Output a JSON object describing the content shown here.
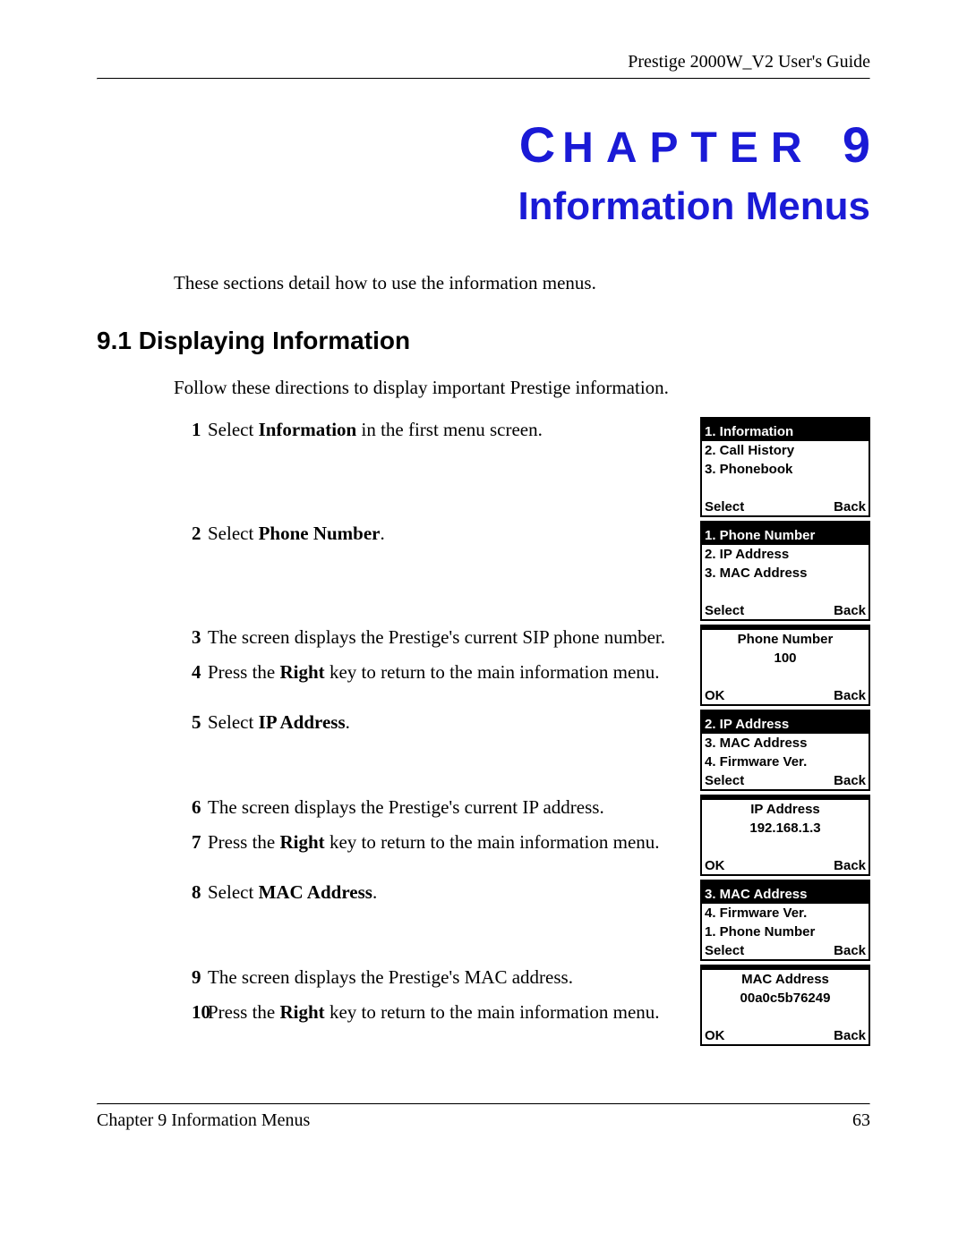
{
  "header": {
    "running_head": "Prestige 2000W_V2 User's Guide"
  },
  "chapter": {
    "label_prefix_letter": "C",
    "label_rest": "HAPTER",
    "number": "9",
    "title": "Information Menus",
    "intro": "These sections detail how to use the information menus."
  },
  "section": {
    "heading": "9.1  Displaying Information",
    "intro": "Follow these directions to display important Prestige information."
  },
  "steps": {
    "s1": {
      "num": "1",
      "t1": "Select ",
      "b1": "Information",
      "t2": " in the first menu screen."
    },
    "s2": {
      "num": "2",
      "t1": "Select ",
      "b1": "Phone Number",
      "t2": "."
    },
    "s3": {
      "num": "3",
      "txt": "The screen displays the Prestige's current SIP phone number."
    },
    "s4": {
      "num": "4",
      "t1": "Press the ",
      "b1": "Right",
      "t2": " key to return to the main information menu."
    },
    "s5": {
      "num": "5",
      "t1": "Select ",
      "b1": "IP Address",
      "t2": "."
    },
    "s6": {
      "num": "6",
      "txt": "The screen displays the Prestige's current IP address."
    },
    "s7": {
      "num": "7",
      "t1": "Press the ",
      "b1": "Right",
      "t2": " key to return to the main information menu."
    },
    "s8": {
      "num": "8",
      "t1": "Select ",
      "b1": "MAC Address",
      "t2": "."
    },
    "s9": {
      "num": "9",
      "txt": "The screen displays the Prestige's MAC address."
    },
    "s10": {
      "num": "10",
      "t1": "Press the ",
      "b1": "Right",
      "t2": " key to return to the main information menu."
    }
  },
  "screens": {
    "sc1": {
      "title": "1. Information",
      "row1": "2. Call History",
      "row2": "3. Phonebook",
      "left": "Select",
      "right": "Back"
    },
    "sc2": {
      "title": "1. Phone Number",
      "row1": "2. IP Address",
      "row2": "3. MAC Address",
      "left": "Select",
      "right": "Back"
    },
    "sc3": {
      "title": "Phone Number",
      "value": "100",
      "left": "OK",
      "right": "Back"
    },
    "sc4": {
      "title": "2. IP Address",
      "row1": "3. MAC Address",
      "row2": "4. Firmware Ver.",
      "left": "Select",
      "right": "Back"
    },
    "sc5": {
      "title": "IP Address",
      "value": "192.168.1.3",
      "left": "OK",
      "right": "Back"
    },
    "sc6": {
      "title": "3. MAC Address",
      "row1": "4. Firmware Ver.",
      "row2": "1. Phone Number",
      "left": "Select",
      "right": "Back"
    },
    "sc7": {
      "title": "MAC Address",
      "value": "00a0c5b76249",
      "left": "OK",
      "right": "Back"
    }
  },
  "footer": {
    "left": "Chapter 9 Information Menus",
    "right": "63"
  }
}
